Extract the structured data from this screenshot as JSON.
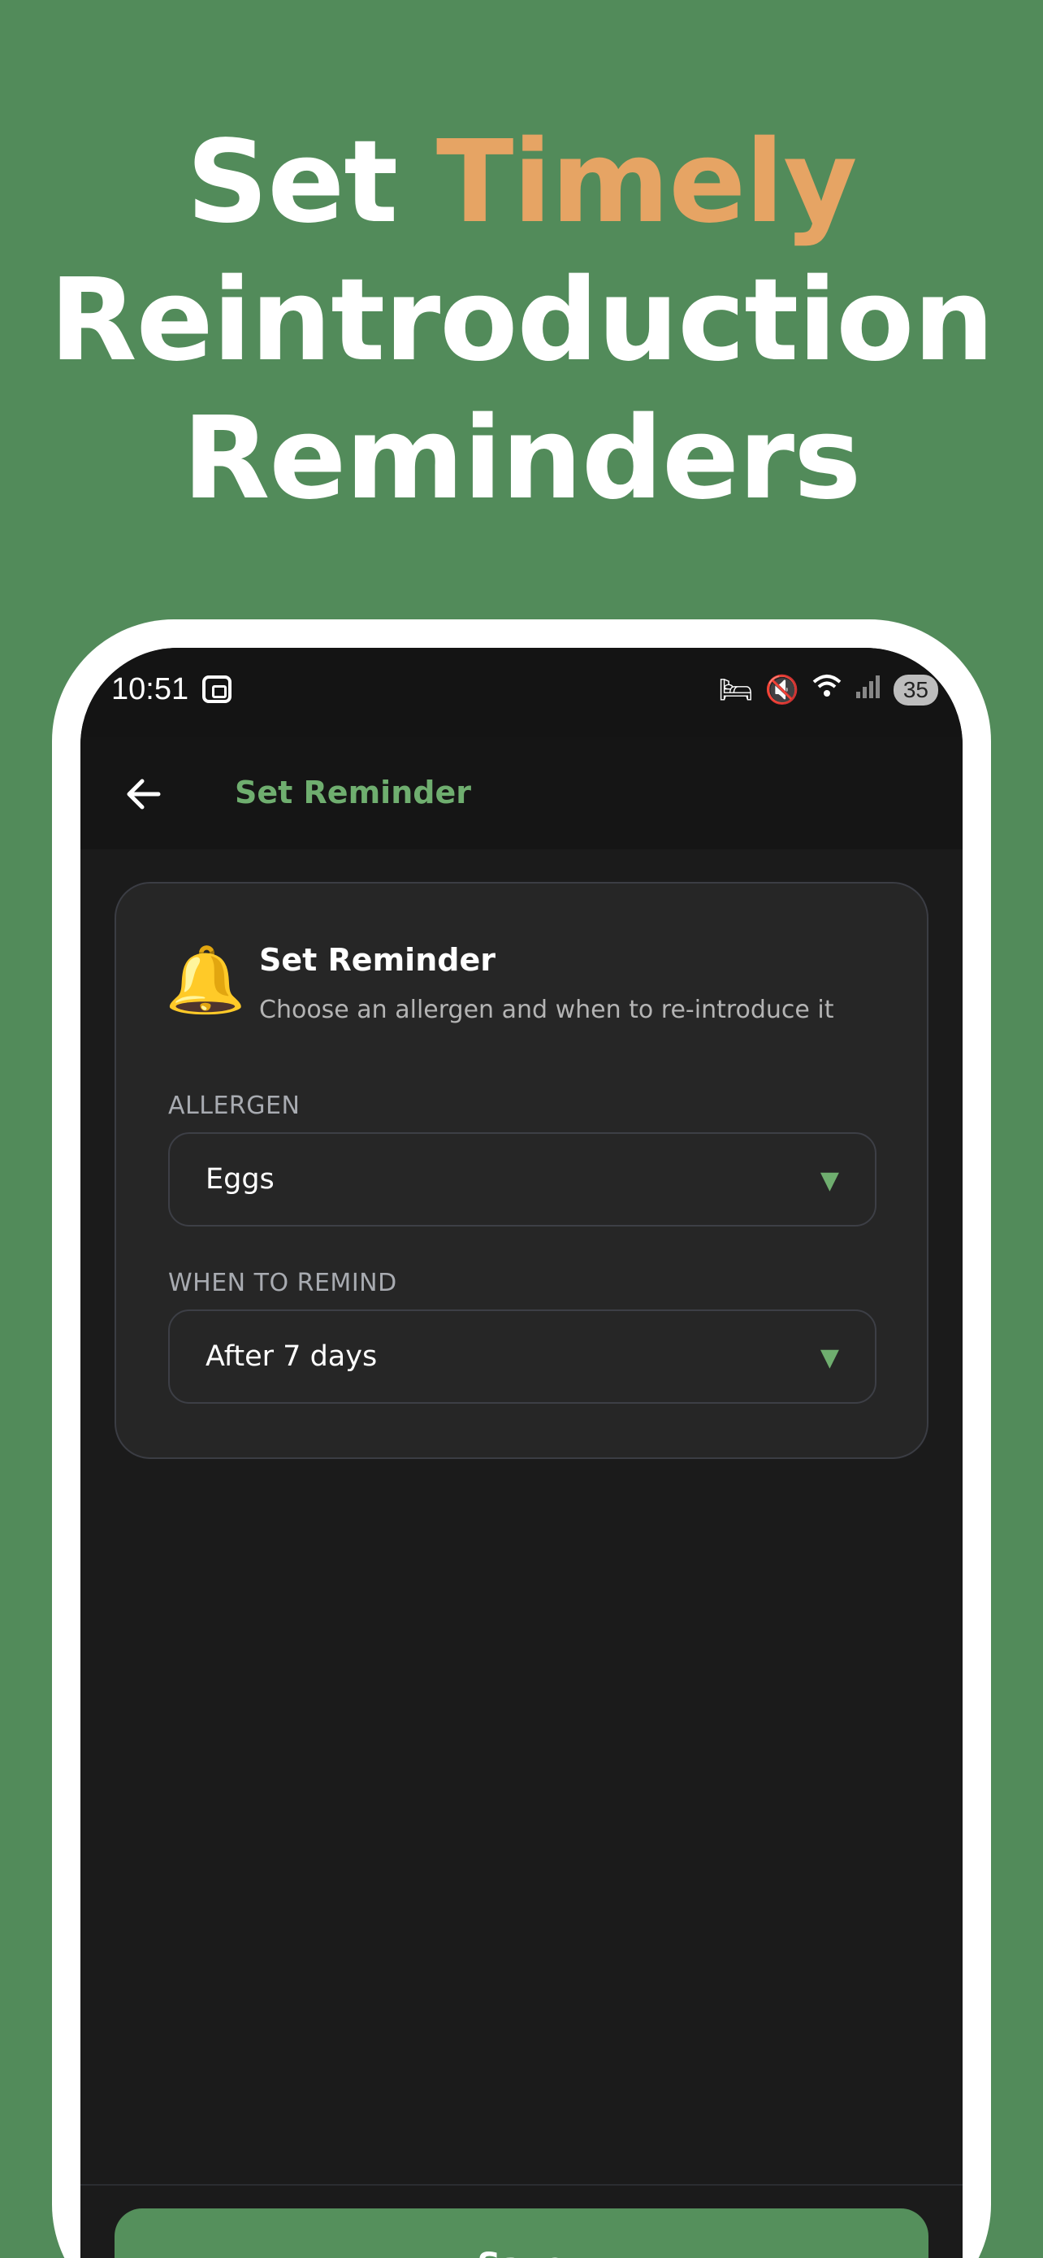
{
  "headline": {
    "word1": "Set",
    "accent": "Timely",
    "line2": "Reintroduction",
    "line3": "Reminders"
  },
  "status_bar": {
    "time": "10:51",
    "battery": "35"
  },
  "app_bar": {
    "back_icon": "arrow-left-icon",
    "title": "Set Reminder"
  },
  "card": {
    "icon": "bell-icon",
    "title": "Set Reminder",
    "subtitle": "Choose an allergen and when to re-introduce it",
    "allergen": {
      "label": "ALLERGEN",
      "value": "Eggs"
    },
    "when": {
      "label": "WHEN TO REMIND",
      "value": "After 7 days"
    }
  },
  "footer": {
    "save_label": "Save"
  },
  "colors": {
    "background": "#528b5a",
    "accent": "#e6a464",
    "brand_green": "#6fae6f",
    "screen": "#1b1b1b",
    "card": "#262626"
  }
}
